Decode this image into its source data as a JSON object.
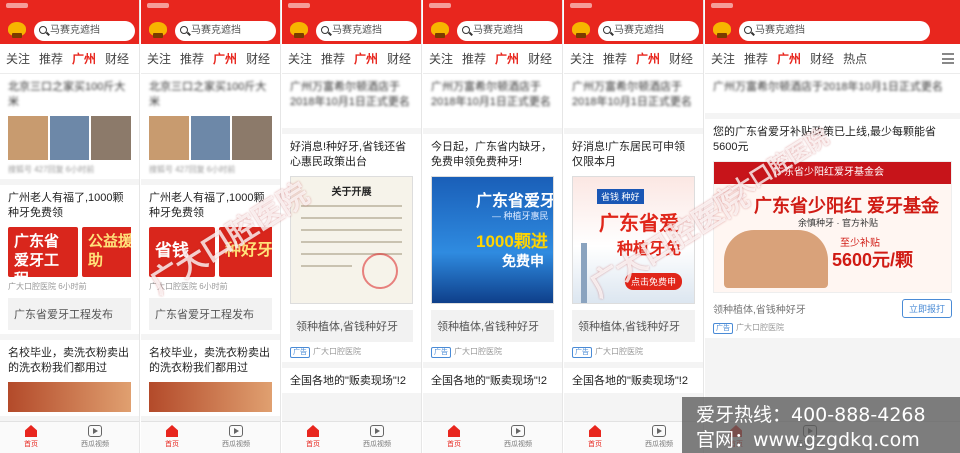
{
  "app": {
    "search_placeholder": "马赛克遮挡",
    "tabs": [
      "关注",
      "推荐",
      "广州",
      "财经",
      "热点"
    ],
    "active_tab": "广州",
    "nav_home": "首页",
    "nav_video": "西瓜视频"
  },
  "panels": [
    {
      "id": "p1",
      "cards": {
        "news1_headline": "北京三口之家买100斤大米",
        "news1_meta": "搜狐号 427回复 6小时前",
        "news2_headline": "广州老人有福了,1000颗种牙免费领",
        "banner1": "广东省爱牙工程",
        "banner2": "公益援助",
        "news2_meta": "广大口腔医院 6小时前",
        "tagline": "广东省爱牙工程发布",
        "news3_headline": "名校毕业，卖洗衣粉卖出的洗衣粉我们都用过"
      }
    },
    {
      "id": "p2",
      "cards": {
        "news1_headline": "北京三口之家买100斤大米",
        "news1_meta": "搜狐号 427回复 6小时前",
        "news2_headline": "广州老人有福了,1000颗种牙免费领",
        "banner1": "省钱",
        "banner2": "种好牙",
        "news2_meta": "广大口腔医院 6小时前",
        "tagline": "广东省爱牙工程发布",
        "news3_headline": "名校毕业，卖洗衣粉卖出的洗衣粉我们都用过"
      }
    },
    {
      "id": "p3",
      "cards": {
        "news1_headline": "广州万富希尔顿酒店于2018年10月1日正式更名",
        "ad_headline": "好消息!种好牙,省钱还省心惠民政策出台",
        "doc_title": "关于开展",
        "ad_caption": "领种植体,省钱种好牙",
        "ad_tag": "广告",
        "ad_source": "广大口腔医院",
        "news3_headline": "全国各地的\"贩卖现场\"!2"
      }
    },
    {
      "id": "p4",
      "cards": {
        "news1_headline": "广州万富希尔顿酒店于2018年10月1日正式更名",
        "ad_headline": "今日起，广东省内缺牙，免费申领免费种牙!",
        "img_title": "广东省爱牙",
        "img_sub": "— 种植牙惠民",
        "img_big": "1000颗进",
        "img_free": "免费申",
        "ad_caption": "领种植体,省钱种好牙",
        "ad_tag": "广告",
        "ad_source": "广大口腔医院",
        "news3_headline": "全国各地的\"贩卖现场\"!2"
      }
    },
    {
      "id": "p5",
      "cards": {
        "news1_headline": "广州万富希尔顿酒店于2018年10月1日正式更名",
        "ad_headline": "好消息!广东居民可申领仅限本月",
        "img_tag": "省钱 种好",
        "img_title": "广东省爱",
        "img_sub": "种植牙免",
        "img_btn": "点击免费申",
        "ad_caption": "领种植体,省钱种好牙",
        "ad_tag": "广告",
        "ad_source": "广大口腔医院",
        "news3_headline": "全国各地的\"贩卖现场\"!2"
      }
    },
    {
      "id": "p6",
      "cards": {
        "news1_headline": "广州万富希尔顿酒店于2018年10月1日正式更名",
        "ad_headline": "您的广东省爱牙补贴政策已上线,最少每颗能省5600元",
        "img_head": "广东省少阳红爱牙基金会",
        "img_title": "广东省少阳红 爱牙基金",
        "img_sub": "余慎种牙 · 官方补贴",
        "img_price_l": "至少补贴",
        "img_price": "5600元/颗",
        "ad_caption": "领种植体,省钱种好牙",
        "apply_btn": "立即报打",
        "ad_tag": "广告",
        "ad_source": "广大口腔医院"
      }
    }
  ],
  "watermark": "广大口腔医院",
  "overlay": {
    "hotline": "爱牙热线：400-888-4268",
    "site": "官网：www.gzgdkq.com"
  },
  "colors": {
    "brand_red": "#e8261e",
    "ad_blue": "#4a8bd6"
  }
}
